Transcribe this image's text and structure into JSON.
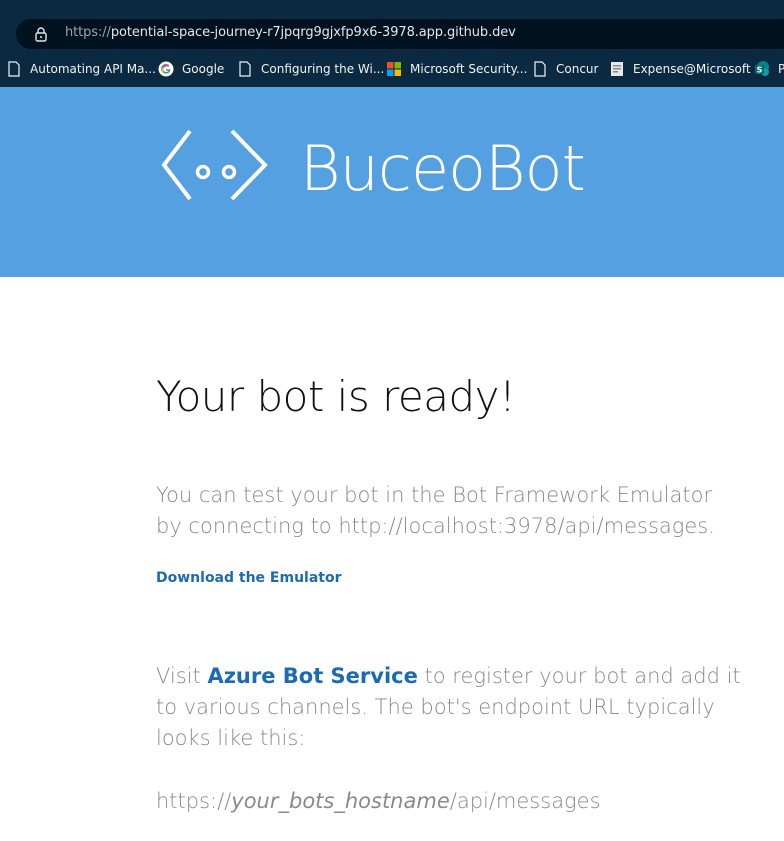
{
  "browser": {
    "url_scheme": "https://",
    "url_rest": "potential-space-journey-r7jpqrg9gjxfp9x6-3978.app.github.dev",
    "bookmarks": [
      {
        "label": "Automating API Ma...",
        "icon": "page-icon"
      },
      {
        "label": "Google",
        "icon": "google-icon"
      },
      {
        "label": "Configuring the Wi...",
        "icon": "page-icon"
      },
      {
        "label": "Microsoft Security...",
        "icon": "microsoft-icon"
      },
      {
        "label": "Concur",
        "icon": "page-icon"
      },
      {
        "label": "Expense@Microsoft",
        "icon": "expense-icon"
      },
      {
        "label": "P",
        "icon": "sharepoint-icon"
      }
    ]
  },
  "banner": {
    "brand": "BuceoBot",
    "background": "#55a0e0"
  },
  "main": {
    "title": "Your bot is ready!",
    "test_line1": "You can test your bot in the Bot Framework Emulator",
    "test_line2": "by connecting to http://localhost:3978/api/messages.",
    "download_link": "Download the Emulator",
    "visit_prefix": "Visit ",
    "azure_link": "Azure Bot Service",
    "visit_suffix": " to register your bot and add it to various channels. The bot's endpoint URL typically looks like this:",
    "endpoint_prefix": "https://",
    "endpoint_host": "your_bots_hostname",
    "endpoint_suffix": "/api/messages"
  },
  "colors": {
    "link": "#1b6ab3",
    "chrome": "#0b2a42"
  }
}
